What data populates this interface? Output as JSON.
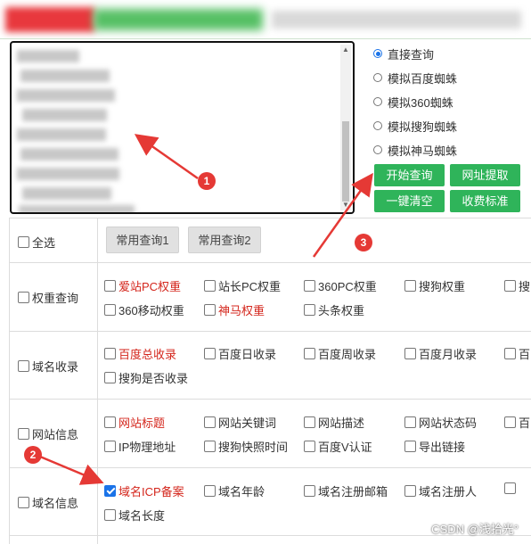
{
  "query_modes": [
    {
      "label": "直接查询",
      "selected": true
    },
    {
      "label": "模拟百度蜘蛛",
      "selected": false
    },
    {
      "label": "模拟360蜘蛛",
      "selected": false
    },
    {
      "label": "模拟搜狗蜘蛛",
      "selected": false
    },
    {
      "label": "模拟神马蜘蛛",
      "selected": false
    }
  ],
  "actions": {
    "start_query": "开始查询",
    "extract_urls": "网址提取",
    "clear_all": "一键清空",
    "pricing": "收费标准"
  },
  "select_all": {
    "label": "全选",
    "checked": false
  },
  "presets": [
    "常用查询1",
    "常用查询2"
  ],
  "groups": {
    "weight": {
      "label": "权重查询",
      "options": [
        {
          "label": "爱站PC权重",
          "red": true,
          "checked": false
        },
        {
          "label": "站长PC权重",
          "red": false,
          "checked": false
        },
        {
          "label": "360PC权重",
          "red": false,
          "checked": false
        },
        {
          "label": "搜狗权重",
          "red": false,
          "checked": false
        },
        {
          "label": "搜",
          "red": false,
          "checked": false
        },
        {
          "label": "360移动权重",
          "red": false,
          "checked": false
        },
        {
          "label": "神马权重",
          "red": true,
          "checked": false
        },
        {
          "label": "头条权重",
          "red": false,
          "checked": false
        }
      ]
    },
    "index": {
      "label": "域名收录",
      "options": [
        {
          "label": "百度总收录",
          "red": true,
          "checked": false
        },
        {
          "label": "百度日收录",
          "red": false,
          "checked": false
        },
        {
          "label": "百度周收录",
          "red": false,
          "checked": false
        },
        {
          "label": "百度月收录",
          "red": false,
          "checked": false
        },
        {
          "label": "百",
          "red": false,
          "checked": false
        },
        {
          "label": "搜狗是否收录",
          "red": false,
          "checked": false
        }
      ]
    },
    "site": {
      "label": "网站信息",
      "options": [
        {
          "label": "网站标题",
          "red": true,
          "checked": false
        },
        {
          "label": "网站关键词",
          "red": false,
          "checked": false
        },
        {
          "label": "网站描述",
          "red": false,
          "checked": false
        },
        {
          "label": "网站状态码",
          "red": false,
          "checked": false
        },
        {
          "label": "百",
          "red": false,
          "checked": false
        },
        {
          "label": "IP物理地址",
          "red": false,
          "checked": false
        },
        {
          "label": "搜狗快照时间",
          "red": false,
          "checked": false
        },
        {
          "label": "百度V认证",
          "red": false,
          "checked": false
        },
        {
          "label": "导出链接",
          "red": false,
          "checked": false
        }
      ]
    },
    "domain": {
      "label": "域名信息",
      "options": [
        {
          "label": "域名ICP备案",
          "red": true,
          "checked": true
        },
        {
          "label": "域名年龄",
          "red": false,
          "checked": false
        },
        {
          "label": "域名注册邮箱",
          "red": false,
          "checked": false
        },
        {
          "label": "域名注册人",
          "red": false,
          "checked": false
        },
        {
          "label": "域名长度",
          "red": false,
          "checked": false
        }
      ]
    }
  },
  "annotations": {
    "step1": "1",
    "step2": "2",
    "step3": "3"
  },
  "watermark": "CSDN @浅拾光°",
  "colors": {
    "accent_green": "#2fb45a",
    "annotation_red": "#e53935",
    "highlight_text": "#d4261c",
    "selected_blue": "#1a73e8"
  }
}
